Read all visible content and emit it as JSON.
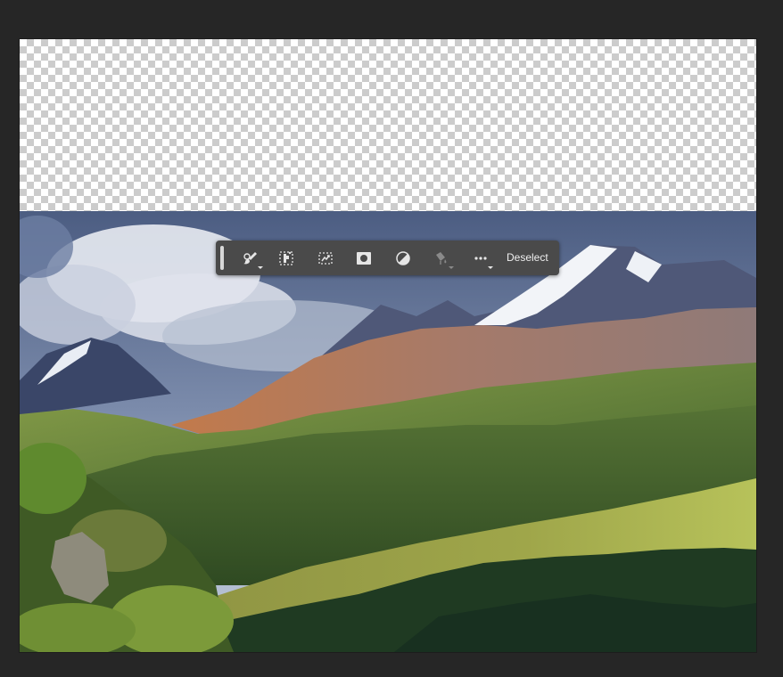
{
  "toolbar": {
    "buttons": [
      {
        "icon": "brush-mask-icon",
        "has_menu": true
      },
      {
        "icon": "select-subject-icon",
        "has_menu": false
      },
      {
        "icon": "transform-selection-icon",
        "has_menu": false
      },
      {
        "icon": "create-mask-icon",
        "has_menu": false
      },
      {
        "icon": "adjustment-layer-icon",
        "has_menu": false
      },
      {
        "icon": "fill-icon",
        "has_menu": true,
        "disabled": true
      },
      {
        "icon": "more-options-icon",
        "has_menu": true
      }
    ],
    "deselect_label": "Deselect"
  },
  "colors": {
    "workspace": "#262626",
    "toolbar_bg": "#4a4a4a",
    "icon": "#e6e6e6"
  }
}
